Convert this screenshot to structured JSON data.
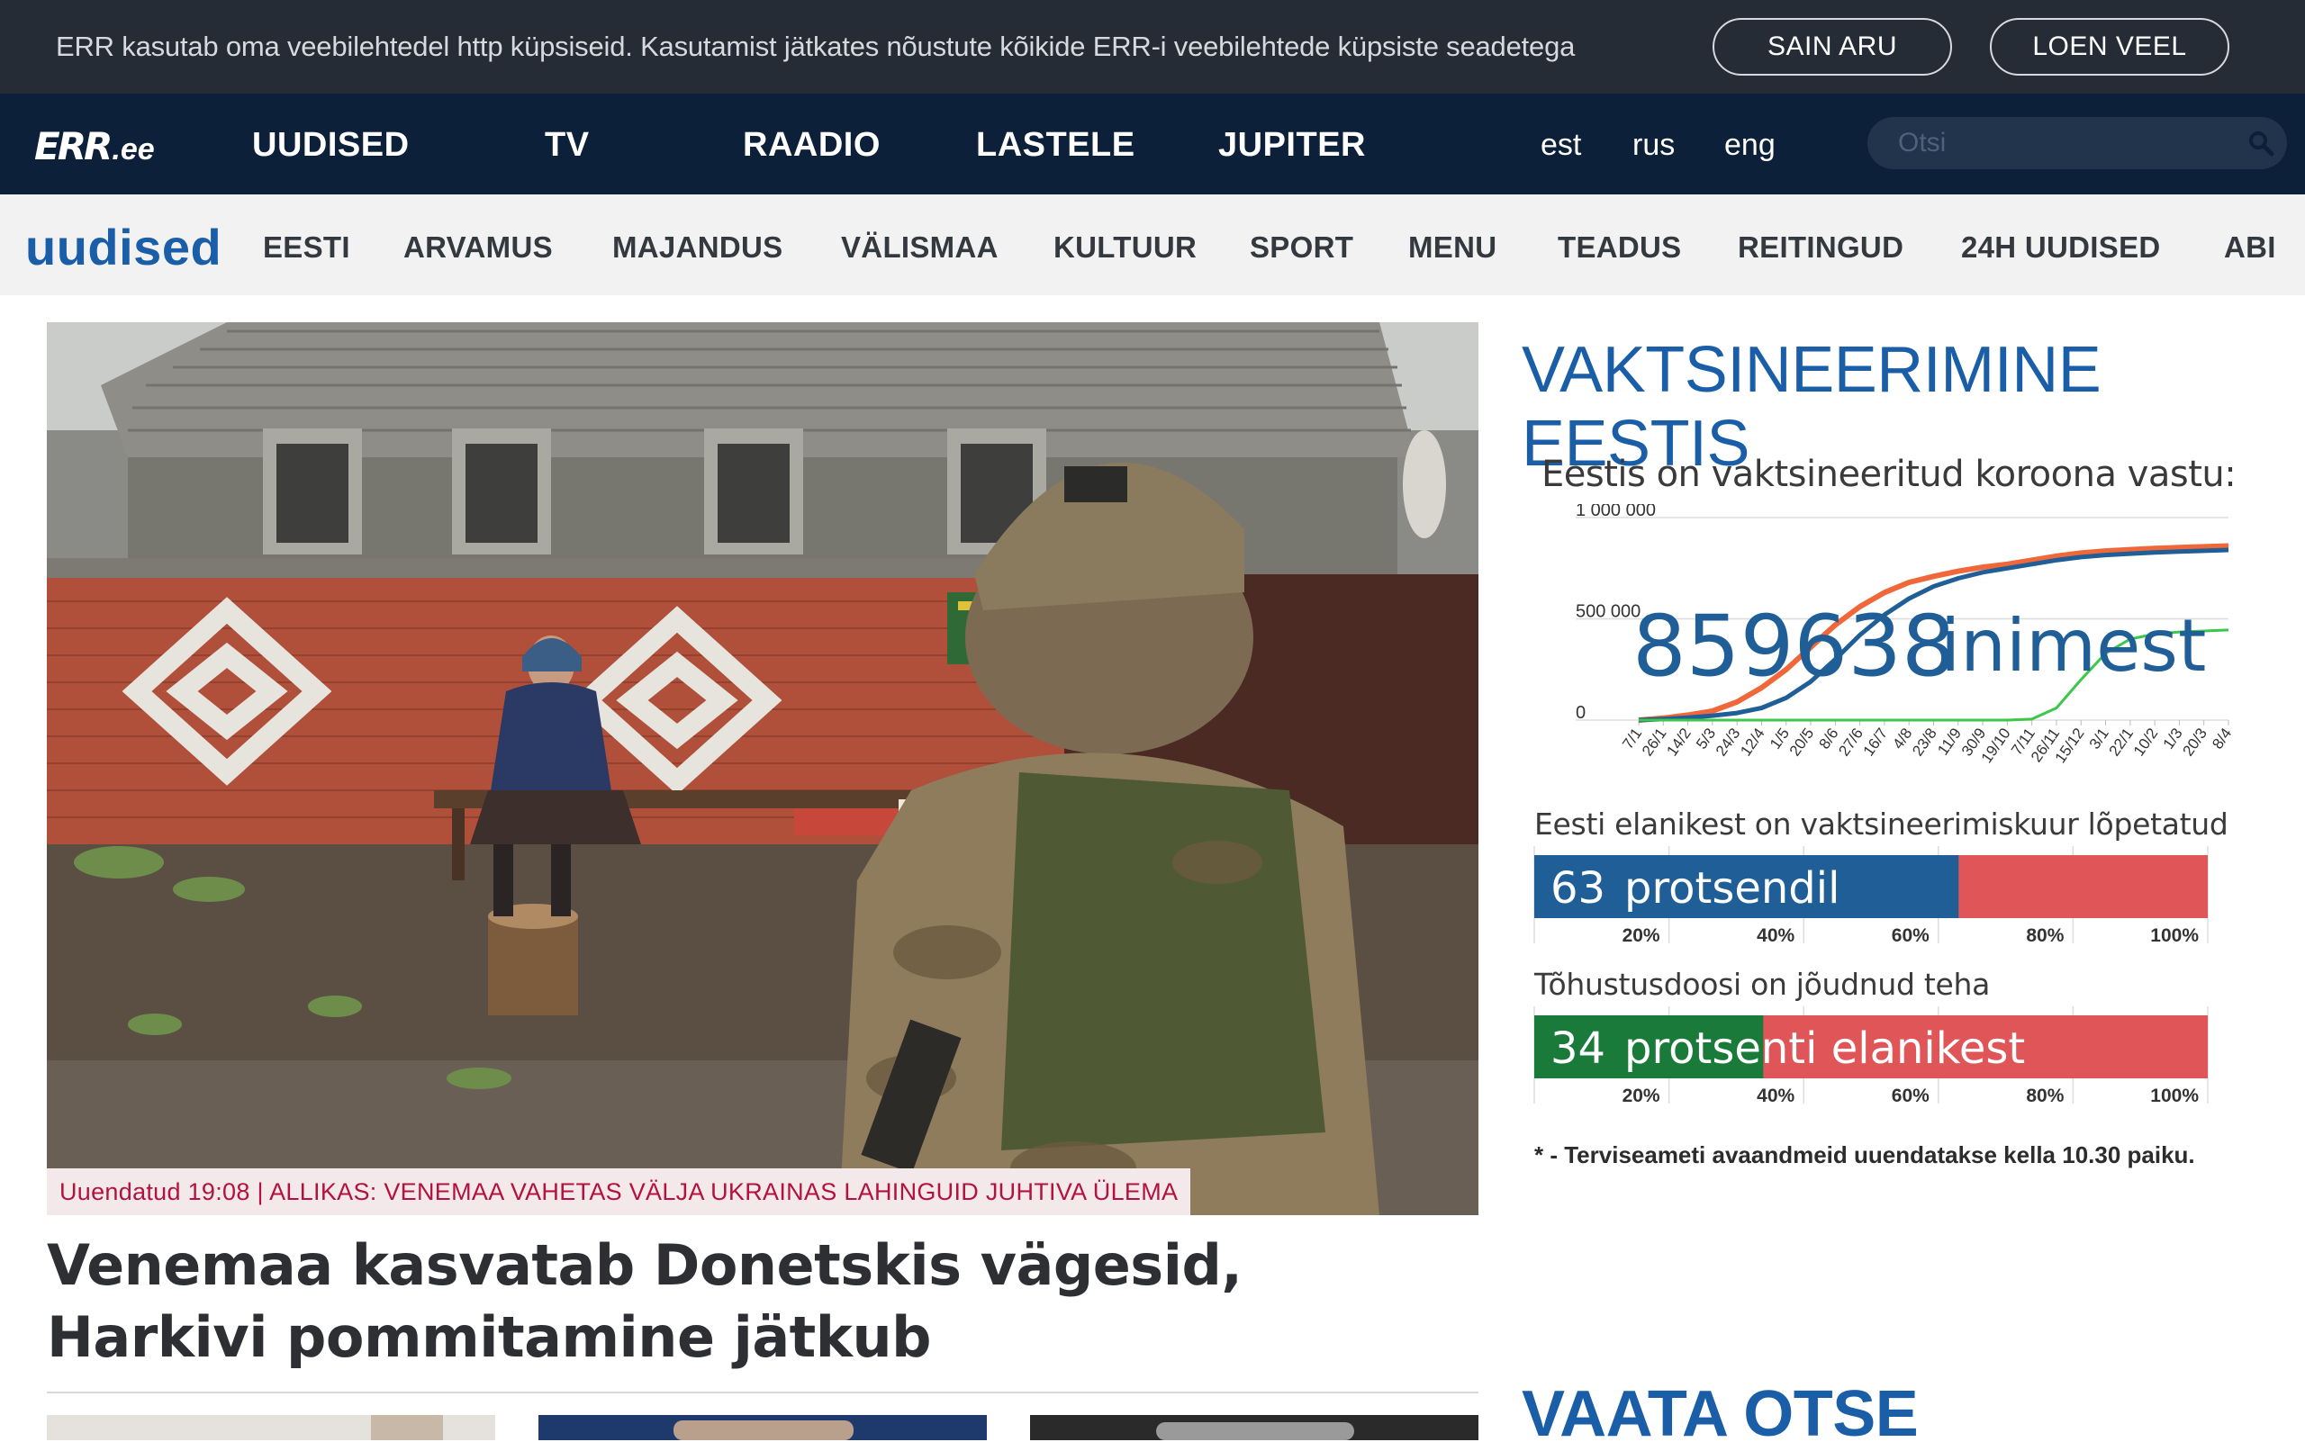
{
  "cookie": {
    "text": "ERR kasutab oma veebilehtedel http küpsiseid. Kasutamist jätkates nõustute kõikide ERR-i veebilehtede küpsiste seadetega",
    "accept_label": "SAIN ARU",
    "more_label": "LOEN VEEL"
  },
  "top_nav": {
    "logo_mark": "ERR",
    "logo_suffix": ".ee",
    "items": [
      "UUDISED",
      "TV",
      "RAADIO",
      "LASTELE",
      "JUPITER"
    ],
    "languages": [
      "est",
      "rus",
      "eng"
    ],
    "search_placeholder": "Otsi"
  },
  "sub_nav": {
    "brand": "uudised",
    "items": [
      "EESTI",
      "ARVAMUS",
      "MAJANDUS",
      "VÄLISMAA",
      "KULTUUR",
      "SPORT",
      "MENU",
      "TEADUS",
      "REITINGUD",
      "24H UUDISED",
      "ABI"
    ]
  },
  "hero": {
    "caption": "Uuendatud 19:08 | ALLIKAS: VENEMAA VAHETAS VÄLJA UKRAINAS LAHINGUID JUHTIVA ÜLEMA",
    "headline": "Venemaa kasvatab Donetskis vägesid, Harkivi pommitamine jätkub"
  },
  "sidebar": {
    "title": "VAKTSINEERIMINE EESTIS",
    "title2": "VAATA OTSE",
    "footnote": "* - Terviseameti avaandmeid uuendatakse kella 10.30 paiku.",
    "colors": {
      "orange": "#f0683a",
      "blue": "#1f5e96",
      "green": "#3cc64a",
      "red": "#e05558",
      "darkgreen": "#1a7a3a"
    }
  },
  "chart_data": [
    {
      "type": "line",
      "title": "Eestis on vaktsineeritud koroona vastu:",
      "overlay_value": "859638",
      "overlay_unit": "inimest",
      "ytick_labels": [
        "1 000 000",
        "500 000",
        "0"
      ],
      "ylim": [
        0,
        1000000
      ],
      "categories": [
        "7/1",
        "26/1",
        "14/2",
        "5/3",
        "24/3",
        "12/4",
        "1/5",
        "20/5",
        "8/6",
        "27/6",
        "16/7",
        "4/8",
        "23/8",
        "11/9",
        "30/9",
        "19/10",
        "7/11",
        "26/11",
        "15/12",
        "3/1",
        "22/1",
        "10/2",
        "1/3",
        "20/3",
        "8/4"
      ],
      "series": [
        {
          "values": [
            0,
            10000,
            25000,
            45000,
            90000,
            160000,
            250000,
            360000,
            470000,
            560000,
            630000,
            680000,
            710000,
            735000,
            755000,
            770000,
            790000,
            810000,
            825000,
            835000,
            842000,
            848000,
            852000,
            856000,
            860000
          ]
        },
        {
          "values": [
            0,
            5000,
            12000,
            22000,
            35000,
            60000,
            110000,
            190000,
            300000,
            420000,
            520000,
            600000,
            660000,
            700000,
            730000,
            750000,
            770000,
            790000,
            805000,
            815000,
            822000,
            828000,
            832000,
            836000,
            840000
          ]
        },
        {
          "values": [
            0,
            0,
            0,
            0,
            0,
            0,
            0,
            0,
            0,
            0,
            0,
            0,
            0,
            0,
            0,
            0,
            5000,
            60000,
            200000,
            330000,
            400000,
            425000,
            435000,
            440000,
            445000
          ]
        }
      ]
    },
    {
      "type": "bar",
      "title": "Eesti elanikest on vaktsineerimiskuur lõpetatud",
      "value": 63,
      "value_label": "63",
      "unit_label": "protsendil",
      "xlim": [
        0,
        100
      ],
      "tick_labels": [
        "20%",
        "40%",
        "60%",
        "80%",
        "100%"
      ]
    },
    {
      "type": "bar",
      "title": "Tõhustusdoosi on jõudnud teha",
      "value": 34,
      "value_label": "34",
      "unit_label": "protsenti elanikest",
      "xlim": [
        0,
        100
      ],
      "tick_labels": [
        "20%",
        "40%",
        "60%",
        "80%",
        "100%"
      ]
    }
  ]
}
